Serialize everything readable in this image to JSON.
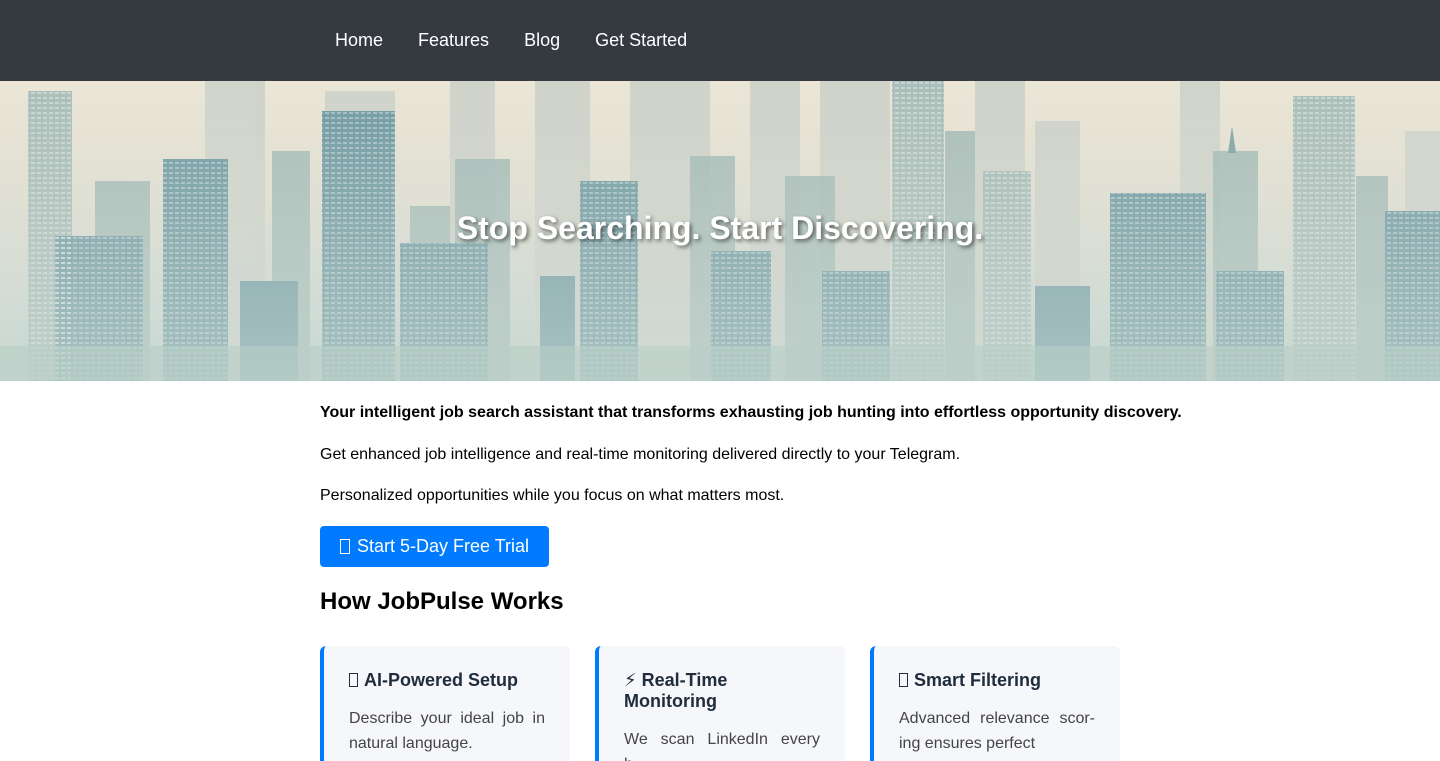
{
  "nav": {
    "items": [
      "Home",
      "Features",
      "Blog",
      "Get Started"
    ]
  },
  "hero": {
    "title": "Stop Searching. Start Discovering."
  },
  "intro": {
    "lead": "Your intelligent job search assistant that transforms exhausting job hunting into effortless opportunity discovery.",
    "line2": "Get enhanced job intelligence and real-time monitoring delivered directly to your Telegram.",
    "line3": "Personalized opportunities while you focus on what matters most."
  },
  "cta": {
    "label": "Start 5-Day Free Trial",
    "color": "#007bff"
  },
  "how": {
    "heading": "How JobPulse Works",
    "cards": [
      {
        "icon": "missing-glyph-icon",
        "title": "AI-Powered Setup",
        "text": "Describe your ideal job in natural language."
      },
      {
        "icon": "lightning-icon",
        "glyph": "⚡",
        "title": "Real-Time Monitoring",
        "text": "We scan LinkedIn every h..."
      },
      {
        "icon": "missing-glyph-icon",
        "title": "Smart Filtering",
        "text": "Advanced relevance scor- ing ensures perfect"
      }
    ]
  },
  "colors": {
    "nav_bg": "#343a40",
    "accent": "#007bff",
    "card_bg": "#f5f7fa"
  }
}
